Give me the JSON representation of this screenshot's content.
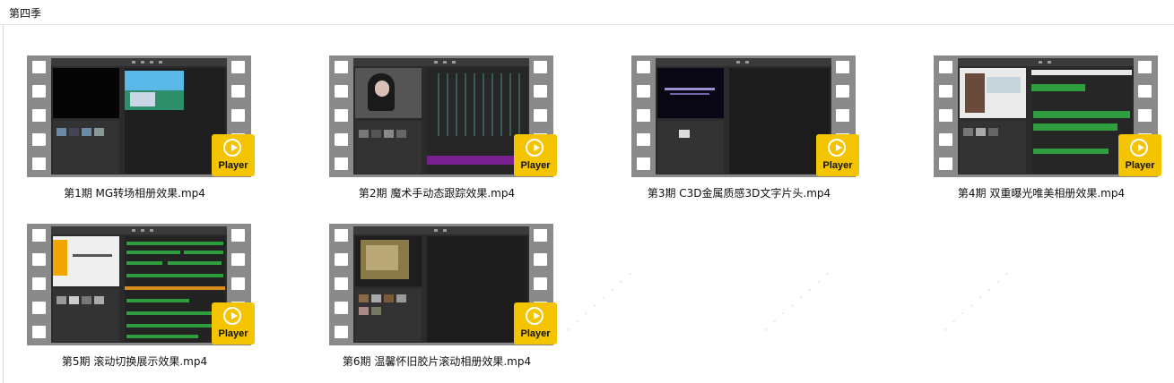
{
  "folder": {
    "title": "第四季"
  },
  "icons": {
    "play": "play-circle-icon",
    "film": "film-strip-thumbnail"
  },
  "colors": {
    "player_badge": "#f5c400",
    "film_frame": "#8a8a8a",
    "app_bg": "#2b2b2b"
  },
  "files": [
    {
      "name": "第1期 MG转场相册效果.mp4",
      "badge": "Player"
    },
    {
      "name": "第2期 魔术手动态跟踪效果.mp4",
      "badge": "Player"
    },
    {
      "name": "第3期 C3D金属质感3D文字片头.mp4",
      "badge": "Player"
    },
    {
      "name": "第4期 双重曝光唯美相册效果.mp4",
      "badge": "Player"
    },
    {
      "name": "第5期 滚动切换展示效果.mp4",
      "badge": "Player"
    },
    {
      "name": "第6期 温馨怀旧胶片滚动相册效果.mp4",
      "badge": "Player"
    }
  ]
}
